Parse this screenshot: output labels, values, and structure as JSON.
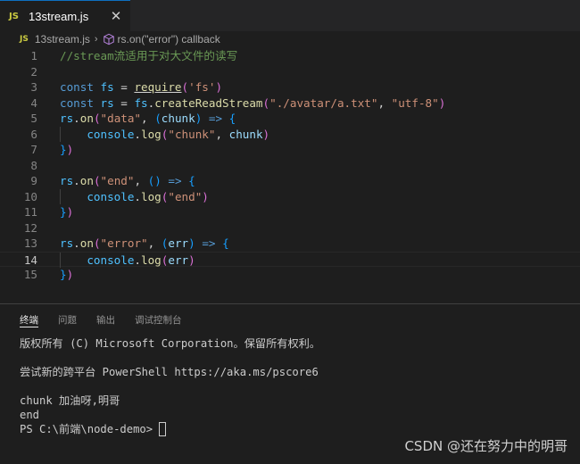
{
  "tab": {
    "badge": "JS",
    "filename": "13stream.js",
    "close_glyph": "✕"
  },
  "breadcrumb": {
    "badge": "JS",
    "file": "13stream.js",
    "separator": "›",
    "symbol": "rs.on(\"error\") callback"
  },
  "colors": {
    "tab_active_border": "#0e70c0",
    "js_badge": "#cbcb41",
    "comment": "#6a9955",
    "keyword": "#569cd6"
  },
  "editor": {
    "line_numbers": [
      "1",
      "2",
      "3",
      "4",
      "5",
      "6",
      "7",
      "8",
      "9",
      "10",
      "11",
      "12",
      "13",
      "14",
      "15"
    ],
    "active_line": "14",
    "lines": [
      {
        "t": [
          [
            "c",
            "//stream流适用于对大文件的读写"
          ]
        ]
      },
      {
        "t": []
      },
      {
        "t": [
          [
            "k",
            "const"
          ],
          [
            "p",
            " "
          ],
          [
            "v",
            "fs"
          ],
          [
            "p",
            " = "
          ],
          [
            "fu",
            "require"
          ],
          [
            "b1",
            "("
          ],
          [
            "s",
            "'fs'"
          ],
          [
            "b1",
            ")"
          ]
        ]
      },
      {
        "t": [
          [
            "k",
            "const"
          ],
          [
            "p",
            " "
          ],
          [
            "v",
            "rs"
          ],
          [
            "p",
            " = "
          ],
          [
            "v",
            "fs"
          ],
          [
            "p",
            "."
          ],
          [
            "f",
            "createReadStream"
          ],
          [
            "b1",
            "("
          ],
          [
            "s",
            "\"./avatar/a.txt\""
          ],
          [
            "p",
            ", "
          ],
          [
            "s",
            "\"utf-8\""
          ],
          [
            "b1",
            ")"
          ]
        ]
      },
      {
        "t": [
          [
            "v",
            "rs"
          ],
          [
            "p",
            "."
          ],
          [
            "f",
            "on"
          ],
          [
            "b1",
            "("
          ],
          [
            "s",
            "\"data\""
          ],
          [
            "p",
            ", "
          ],
          [
            "b2",
            "("
          ],
          [
            "a",
            "chunk"
          ],
          [
            "b2",
            ")"
          ],
          [
            "p",
            " "
          ],
          [
            "k",
            "=>"
          ],
          [
            "p",
            " "
          ],
          [
            "b2",
            "{"
          ]
        ]
      },
      {
        "t": [
          [
            "p",
            "    "
          ],
          [
            "v",
            "console"
          ],
          [
            "p",
            "."
          ],
          [
            "f",
            "log"
          ],
          [
            "b1",
            "("
          ],
          [
            "s",
            "\"chunk\""
          ],
          [
            "p",
            ", "
          ],
          [
            "a",
            "chunk"
          ],
          [
            "b1",
            ")"
          ]
        ]
      },
      {
        "t": [
          [
            "b2",
            "}"
          ],
          [
            "b1",
            ")"
          ]
        ]
      },
      {
        "t": []
      },
      {
        "t": [
          [
            "v",
            "rs"
          ],
          [
            "p",
            "."
          ],
          [
            "f",
            "on"
          ],
          [
            "b1",
            "("
          ],
          [
            "s",
            "\"end\""
          ],
          [
            "p",
            ", "
          ],
          [
            "b2",
            "()"
          ],
          [
            "p",
            " "
          ],
          [
            "k",
            "=>"
          ],
          [
            "p",
            " "
          ],
          [
            "b2",
            "{"
          ]
        ]
      },
      {
        "t": [
          [
            "p",
            "    "
          ],
          [
            "v",
            "console"
          ],
          [
            "p",
            "."
          ],
          [
            "f",
            "log"
          ],
          [
            "b1",
            "("
          ],
          [
            "s",
            "\"end\""
          ],
          [
            "b1",
            ")"
          ]
        ]
      },
      {
        "t": [
          [
            "b2",
            "}"
          ],
          [
            "b1",
            ")"
          ]
        ]
      },
      {
        "t": []
      },
      {
        "t": [
          [
            "v",
            "rs"
          ],
          [
            "p",
            "."
          ],
          [
            "f",
            "on"
          ],
          [
            "b1",
            "("
          ],
          [
            "s",
            "\"error\""
          ],
          [
            "p",
            ", "
          ],
          [
            "b2",
            "("
          ],
          [
            "a",
            "err"
          ],
          [
            "b2",
            ")"
          ],
          [
            "p",
            " "
          ],
          [
            "k",
            "=>"
          ],
          [
            "p",
            " "
          ],
          [
            "b2",
            "{"
          ]
        ]
      },
      {
        "t": [
          [
            "p",
            "    "
          ],
          [
            "v",
            "console"
          ],
          [
            "p",
            "."
          ],
          [
            "f",
            "log"
          ],
          [
            "b1",
            "("
          ],
          [
            "a",
            "err"
          ],
          [
            "b1",
            ")"
          ]
        ]
      },
      {
        "t": [
          [
            "b2",
            "}"
          ],
          [
            "b1",
            ")"
          ]
        ]
      }
    ]
  },
  "panel": {
    "tabs": [
      "终端",
      "问题",
      "输出",
      "调试控制台"
    ],
    "active_tab": "终端",
    "terminal": [
      "版权所有 (C) Microsoft Corporation。保留所有权利。",
      "",
      "尝试新的跨平台 PowerShell https://aka.ms/pscore6",
      "",
      "chunk 加油呀,明哥",
      "end",
      "PS C:\\前端\\node-demo> "
    ]
  },
  "watermark": "CSDN @还在努力中的明哥"
}
